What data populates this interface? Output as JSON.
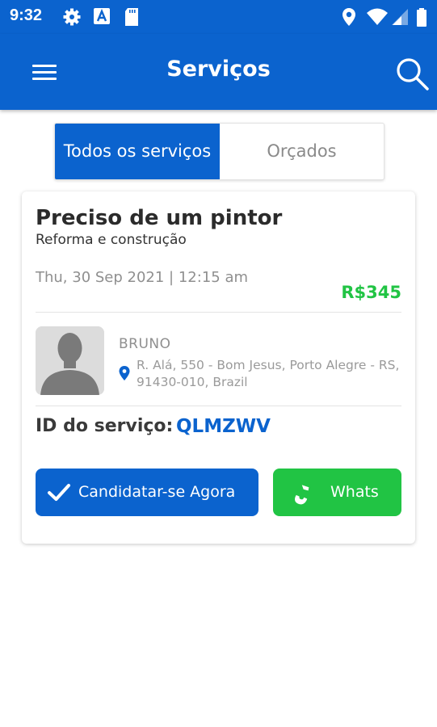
{
  "status_bar": {
    "time": "9:32",
    "left_icons": [
      "gear-icon",
      "app-a-icon",
      "sd-card-icon"
    ],
    "right_icons": [
      "location-icon",
      "wifi-icon",
      "signal-icon",
      "battery-icon"
    ]
  },
  "app_bar": {
    "title": "Serviços",
    "menu_icon": "hamburger-icon",
    "search_icon": "search-icon"
  },
  "tabs": {
    "all": "Todos os serviços",
    "quoted": "Orçados",
    "active": "all"
  },
  "service": {
    "title": "Preciso de um pintor",
    "category": "Reforma e construção",
    "date": "Thu, 30 Sep 2021 | 12:15 am",
    "price": "R$345",
    "client_name": "BRUNO",
    "address": "R. Alá, 550 - Bom Jesus, Porto Alegre - RS, 91430-010, Brazil",
    "id_label": "ID do serviço:",
    "id_value": "QLMZWV"
  },
  "actions": {
    "apply_label": "Candidatar-se Agora",
    "whats_label": "Whats"
  },
  "colors": {
    "primary": "#0b63ce",
    "accent_green": "#21c444"
  }
}
